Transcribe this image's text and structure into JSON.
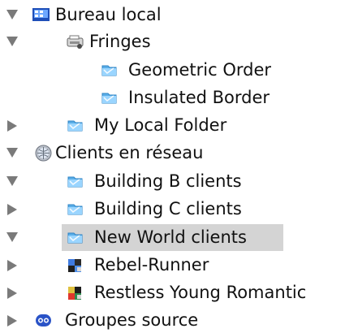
{
  "tree": {
    "items": [
      {
        "label": "Bureau local",
        "state": "expanded",
        "icon": "desktop-icon",
        "level": 0
      },
      {
        "label": "Fringes",
        "state": "expanded",
        "icon": "scanner-icon",
        "level": 1
      },
      {
        "label": "Geometric Order",
        "state": "leaf",
        "icon": "folder-icon",
        "level": 2
      },
      {
        "label": "Insulated Border",
        "state": "leaf",
        "icon": "folder-icon",
        "level": 2
      },
      {
        "label": "My Local Folder",
        "state": "collapsed",
        "icon": "folder-icon",
        "level": 1
      },
      {
        "label": "Clients en réseau",
        "state": "expanded",
        "icon": "network-globe-icon",
        "level": 0
      },
      {
        "label": "Building B clients",
        "state": "expanded",
        "icon": "folder-icon",
        "level": 1
      },
      {
        "label": "Building C clients",
        "state": "collapsed",
        "icon": "folder-icon",
        "level": 1
      },
      {
        "label": "New World clients",
        "state": "expanded",
        "icon": "folder-icon",
        "level": 1,
        "selected": true
      },
      {
        "label": "Rebel-Runner",
        "state": "collapsed",
        "icon": "client-mac-icon",
        "level": 1
      },
      {
        "label": "Restless Young Romantic",
        "state": "collapsed",
        "icon": "client-mac-icon",
        "level": 1
      },
      {
        "label": "Groupes source",
        "state": "collapsed",
        "icon": "source-groups-icon",
        "level": 0
      }
    ]
  },
  "colors": {
    "selection": "#d4d4d4",
    "disclosure": "#7a7a7a",
    "folder": "#5aaee8"
  }
}
